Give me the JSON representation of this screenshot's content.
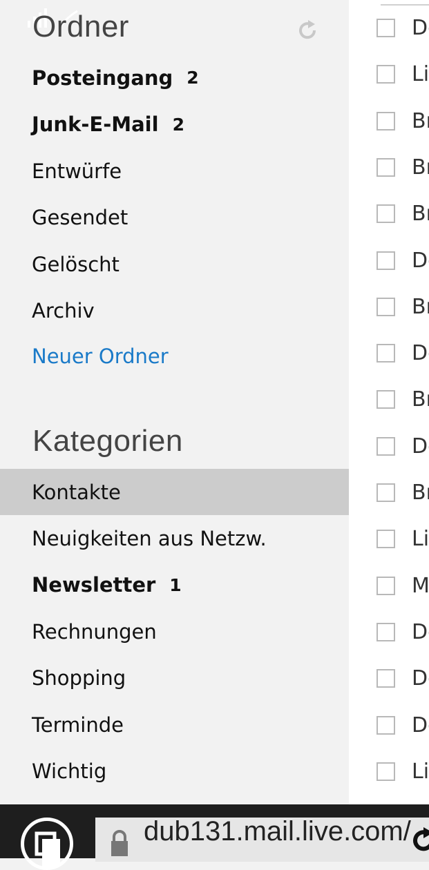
{
  "folders": {
    "title": "Ordner",
    "items": [
      {
        "label": "Posteingang",
        "count": "2"
      },
      {
        "label": "Junk-E-Mail",
        "count": "2"
      },
      {
        "label": "Entwürfe",
        "count": ""
      },
      {
        "label": "Gesendet",
        "count": ""
      },
      {
        "label": "Gelöscht",
        "count": ""
      },
      {
        "label": "Archiv",
        "count": ""
      }
    ],
    "new_folder": "Neuer Ordner"
  },
  "categories": {
    "title": "Kategorien",
    "items": [
      {
        "label": "Kontakte",
        "count": "",
        "selected": true
      },
      {
        "label": "Neuigkeiten aus Netzw.",
        "count": ""
      },
      {
        "label": "Newsletter",
        "count": "1"
      },
      {
        "label": "Rechnungen",
        "count": ""
      },
      {
        "label": "Shopping",
        "count": ""
      },
      {
        "label": "Terminde",
        "count": ""
      },
      {
        "label": "Wichtig",
        "count": ""
      }
    ]
  },
  "message_list": {
    "senders": [
      "De",
      "Lis",
      "Br",
      "Br",
      "Br",
      "De",
      "Br",
      "De",
      "Br",
      "De",
      "Br",
      "Lis",
      "M",
      "De",
      "De",
      "De",
      "Lis"
    ]
  },
  "browser": {
    "url": "dub131.mail.live.com/",
    "icons": [
      "tabs-icon",
      "lock-icon",
      "reload-icon",
      "refresh-icon"
    ]
  },
  "colors": {
    "link": "#1a7ac8",
    "selected_bg": "#cccccc",
    "sidebar_bg": "#f2f2f2"
  }
}
